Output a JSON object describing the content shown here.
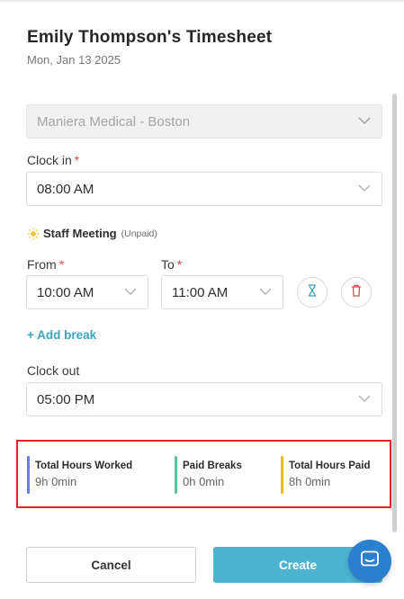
{
  "header": {
    "title": "Emily Thompson's Timesheet",
    "date": "Mon, Jan 13 2025"
  },
  "location": {
    "value": "Maniera Medical - Boston"
  },
  "clock_in": {
    "label": "Clock in",
    "required": "*",
    "value": "08:00 AM"
  },
  "break": {
    "name": "Staff Meeting",
    "type": "(Unpaid)",
    "from_label": "From",
    "to_label": "To",
    "required": "*",
    "from_value": "10:00 AM",
    "to_value": "11:00 AM"
  },
  "add_break": {
    "label": "+ Add break"
  },
  "clock_out": {
    "label": "Clock out",
    "value": "05:00 PM"
  },
  "summary": [
    {
      "label": "Total Hours Worked",
      "value": "9h 0min",
      "color": "#6b7fd7"
    },
    {
      "label": "Paid Breaks",
      "value": "0h 0min",
      "color": "#5cc3a0"
    },
    {
      "label": "Total Hours Paid",
      "value": "8h 0min",
      "color": "#f0b429"
    }
  ],
  "actions": {
    "cancel": "Cancel",
    "create": "Create"
  },
  "icons": {
    "chevron": "chevron-down-icon",
    "sun": "sun-icon",
    "hourglass": "hourglass-icon",
    "delete": "trash-icon",
    "chat": "chat-icon"
  },
  "colors": {
    "accent": "#4cb4d0",
    "required": "#e5474b",
    "highlight": "#e5222a",
    "chat": "#2a7fcf"
  }
}
